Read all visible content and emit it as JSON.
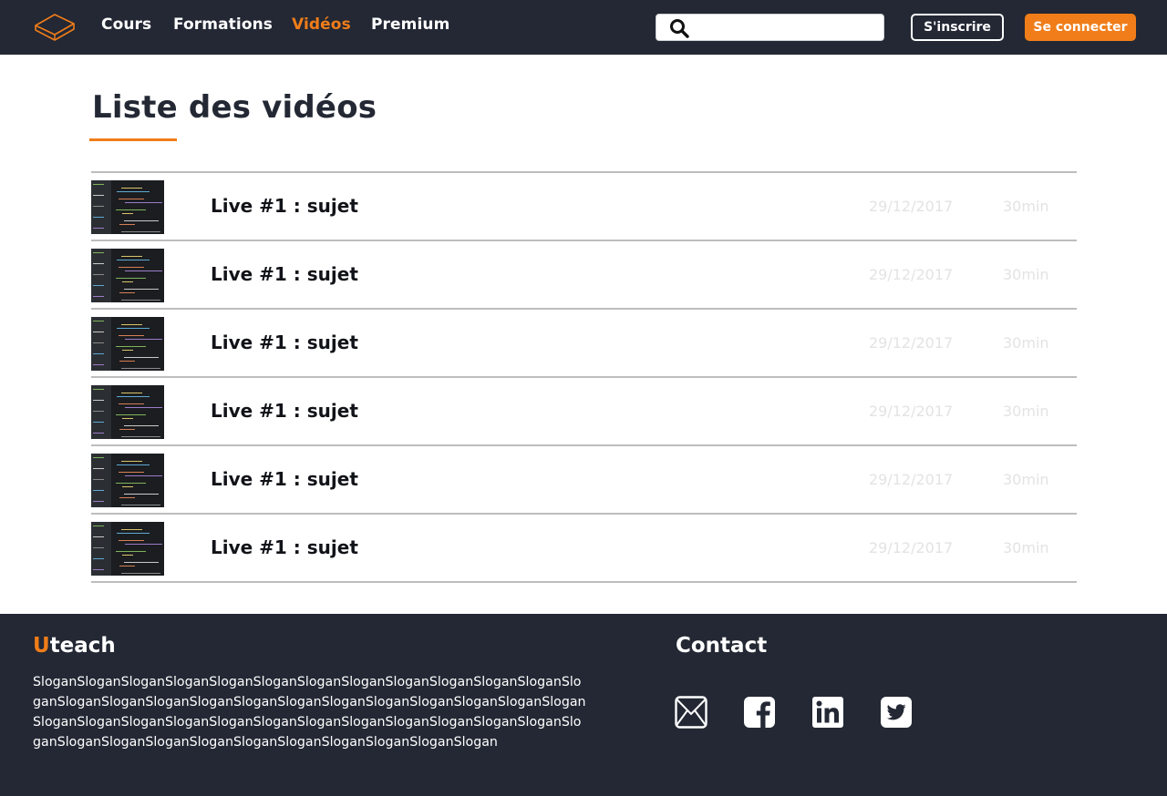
{
  "nav": {
    "links": [
      {
        "label": "Cours"
      },
      {
        "label": "Formations"
      },
      {
        "label": "Vidéos"
      },
      {
        "label": "Premium"
      }
    ],
    "search_placeholder": "",
    "signup_label": "S'inscrire",
    "login_label": "Se connecter"
  },
  "main": {
    "title": "Liste des vidéos",
    "videos": [
      {
        "title": "Live #1 : sujet",
        "date": "29/12/2017",
        "duration": "30min"
      },
      {
        "title": "Live #1 : sujet",
        "date": "29/12/2017",
        "duration": "30min"
      },
      {
        "title": "Live #1 : sujet",
        "date": "29/12/2017",
        "duration": "30min"
      },
      {
        "title": "Live #1 : sujet",
        "date": "29/12/2017",
        "duration": "30min"
      },
      {
        "title": "Live #1 : sujet",
        "date": "29/12/2017",
        "duration": "30min"
      },
      {
        "title": "Live #1 : sujet",
        "date": "29/12/2017",
        "duration": "30min"
      }
    ]
  },
  "footer": {
    "brand_initial": "U",
    "brand_rest": "teach",
    "slogan": "SloganSloganSloganSloganSloganSloganSloganSloganSloganSloganSloganSloganSloganSloganSloganSloganSloganSloganSloganSloganSloganSloganSloganSloganSloganSloganSloganSloganSloganSloganSloganSloganSloganSloganSloganSloganSloganSloganSloganSloganSloganSloganSloganSloganSloganSloganSloganSlogan",
    "contact_title": "Contact",
    "social_icons": [
      "mail-icon",
      "facebook-icon",
      "linkedin-icon",
      "twitter-icon"
    ]
  },
  "colors": {
    "accent": "#f07d19",
    "dark": "#232834",
    "muted_text": "#e3e3e3",
    "divider": "#bdbdbd"
  }
}
